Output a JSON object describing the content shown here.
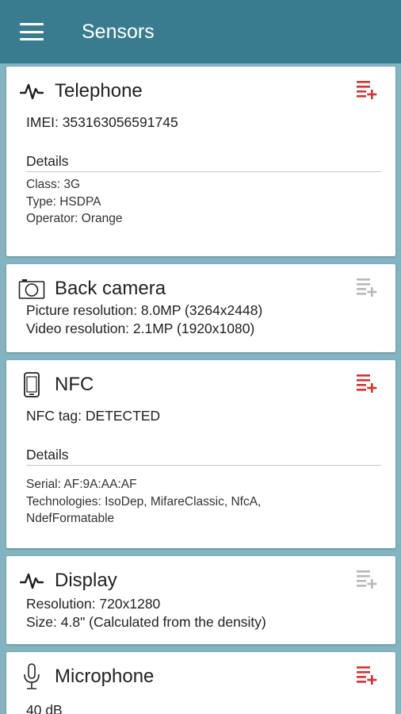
{
  "app": {
    "title": "Sensors"
  },
  "colors": {
    "appbar": "#3a7c8f",
    "background": "#84b3c1",
    "add_active": "#d9302f",
    "add_inactive": "#b8b8b8"
  },
  "cards": [
    {
      "id": "telephone",
      "icon": "pulse-icon",
      "title": "Telephone",
      "add_active": true,
      "main": [
        "IMEI: 353163056591745"
      ],
      "details_label": "Details",
      "details": [
        "Class: 3G",
        "Type: HSDPA",
        "Operator: Orange"
      ]
    },
    {
      "id": "back-camera",
      "icon": "camera-icon",
      "title": "Back camera",
      "add_active": false,
      "main": [
        "Picture resolution: 8.0MP (3264x2448)",
        "Video resolution: 2.1MP (1920x1080)"
      ]
    },
    {
      "id": "nfc",
      "icon": "phone-icon",
      "title": "NFC",
      "add_active": true,
      "main": [
        "NFC tag: DETECTED"
      ],
      "details_label": "Details",
      "details": [
        "Serial: AF:9A:AA:AF",
        "Technologies: IsoDep, MifareClassic, NfcA,",
        "NdefFormatable"
      ]
    },
    {
      "id": "display",
      "icon": "pulse-icon",
      "title": "Display",
      "add_active": false,
      "main": [
        "Resolution: 720x1280",
        "Size: 4.8\" (Calculated from the density)"
      ]
    },
    {
      "id": "microphone",
      "icon": "microphone-icon",
      "title": "Microphone",
      "add_active": true,
      "main": [
        "40 dB"
      ]
    }
  ]
}
